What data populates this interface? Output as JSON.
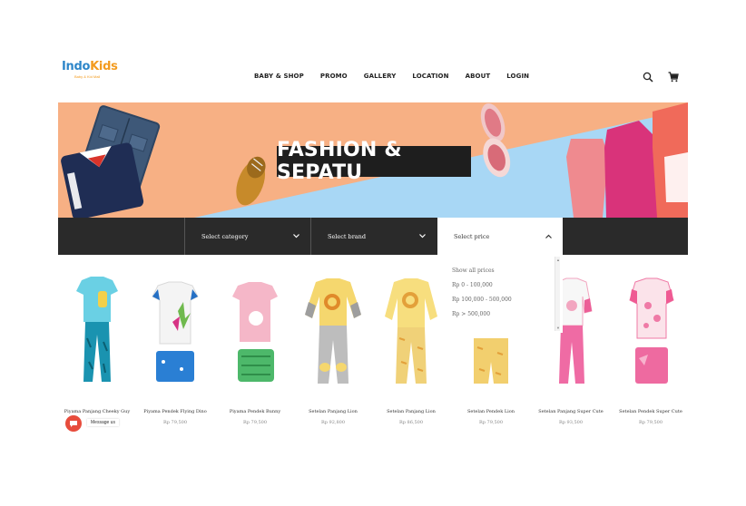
{
  "brand": {
    "name_part1": "Indo",
    "name_part2": "Kids",
    "tagline": "Baby & Kid Mall"
  },
  "nav": [
    {
      "label": "BABY & SHOP"
    },
    {
      "label": "PROMO"
    },
    {
      "label": "GALLERY"
    },
    {
      "label": "LOCATION"
    },
    {
      "label": "ABOUT"
    },
    {
      "label": "LOGIN"
    }
  ],
  "header_icons": {
    "search": "search-icon",
    "cart": "cart-icon"
  },
  "banner": {
    "title": "FASHION & SEPATU"
  },
  "filters": {
    "category": "Select category",
    "brand": "Select brand",
    "price": "Select price"
  },
  "price_options": [
    "Show all prices",
    "Rp 0 - 100,000",
    "Rp 100,000 - 500,000",
    "Rp > 500,000"
  ],
  "products": [
    {
      "name": "Piyama Panjang Cheeky Guy",
      "price": ""
    },
    {
      "name": "Piyama Pendek Flying Dino",
      "price": "Rp 79,500"
    },
    {
      "name": "Piyama Pendek Bunny",
      "price": "Rp 79,500"
    },
    {
      "name": "Setelan Panjang Lion",
      "price": "Rp 92,800"
    },
    {
      "name": "Setelan Panjang Lion",
      "price": "Rp 86,500"
    },
    {
      "name": "Setelan Pendek Lion",
      "price": "Rp 79,500"
    },
    {
      "name": "Setelan Panjang Super Cute",
      "price": "Rp 93,500"
    },
    {
      "name": "Setelan Pendek Super Cute",
      "price": "Rp 79,500"
    }
  ],
  "chat": {
    "label": "Message us"
  },
  "colors": {
    "banner_peach": "#f7b084",
    "banner_blue": "#a8d7f5",
    "filter_bg": "#2a2a2a",
    "logo_blue": "#2d86c9",
    "logo_orange": "#f39b1f",
    "chat_red": "#e74c3c"
  }
}
